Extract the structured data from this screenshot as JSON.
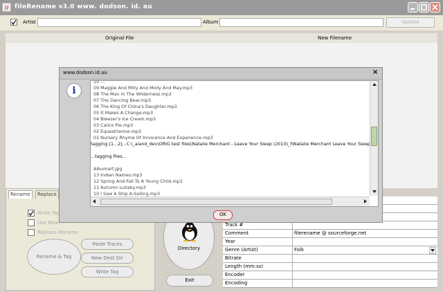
{
  "window": {
    "title": "fileRename v3.0     www. dodson. id. au"
  },
  "toolbar": {
    "artist_label": "Artist",
    "album_label": "Album",
    "update_label": "Update",
    "artist_value": "",
    "album_value": ""
  },
  "table": {
    "columns": [
      "Original File",
      "New Filename"
    ]
  },
  "left_panel": {
    "tabs": [
      "Rename",
      "Replace"
    ],
    "options": [
      {
        "label": "Write Tag",
        "checked": true
      },
      {
        "label": "Use New ...",
        "checked": false
      },
      {
        "label": "Replace Rename",
        "checked": false
      }
    ],
    "buttons": {
      "rename_tag": "Rename & Tag",
      "paste_tracks": "Paste Tracks",
      "new_dest_dir": "New Dest Dir",
      "write_tag": "Write Tag"
    }
  },
  "middle": {
    "directory_label": "Directory",
    "exit_label": "Exit"
  },
  "properties": [
    {
      "key": "",
      "value": ""
    },
    {
      "key": "",
      "value": ""
    },
    {
      "key": "",
      "value": ""
    },
    {
      "key": "Track #",
      "value": ""
    },
    {
      "key": "Comment",
      "value": "filerename @ sourceforge.net"
    },
    {
      "key": "Year",
      "value": ""
    },
    {
      "key": "Genre (Artist)",
      "value": "Folk"
    },
    {
      "key": "Bitrate",
      "value": ""
    },
    {
      "key": "Length (mm:ss)",
      "value": ""
    },
    {
      "key": "Encoder",
      "value": ""
    },
    {
      "key": "Encoding",
      "value": ""
    }
  ],
  "dialog": {
    "title": "www.dodson.id.au",
    "ok_label": "OK",
    "log_lines": [
      "10 ...",
      "09 Maggie And Milly And Molly And May.mp3",
      "08 The Man In The Wilderness.mp3",
      "07 The Dancing Bear.mp3",
      "06 The King Of China's Daughter.mp3",
      "05 It Makes A Change.mp3",
      "04 Bleezer's Ice Cream.mp3",
      "03 Calico Pie.mp3",
      "02 Equestrienne.mp3",
      "01 Nursery Rhyme Of Innocence And Experience.mp3",
      "tagging [1...2]...C:\\_aland_dev\\ORIG test files\\Natalie Merchant - Leave Your Sleep (2010)_f\\Natalie Merchant Leave Your Sleep (",
      "",
      "...tagging files...",
      "",
      "Albumart.jpg",
      "13 Indian Names.mp3",
      "12 Spring And Fall To A Young Child.mp3",
      "11 Autumn Lullaby.mp3",
      "10 I Saw A Ship A-Sailing.mp3"
    ]
  },
  "colors": {
    "titlebar": "#9a9a9a",
    "dialog_bg": "#cfcfcf",
    "ok_border": "#cc4444"
  }
}
